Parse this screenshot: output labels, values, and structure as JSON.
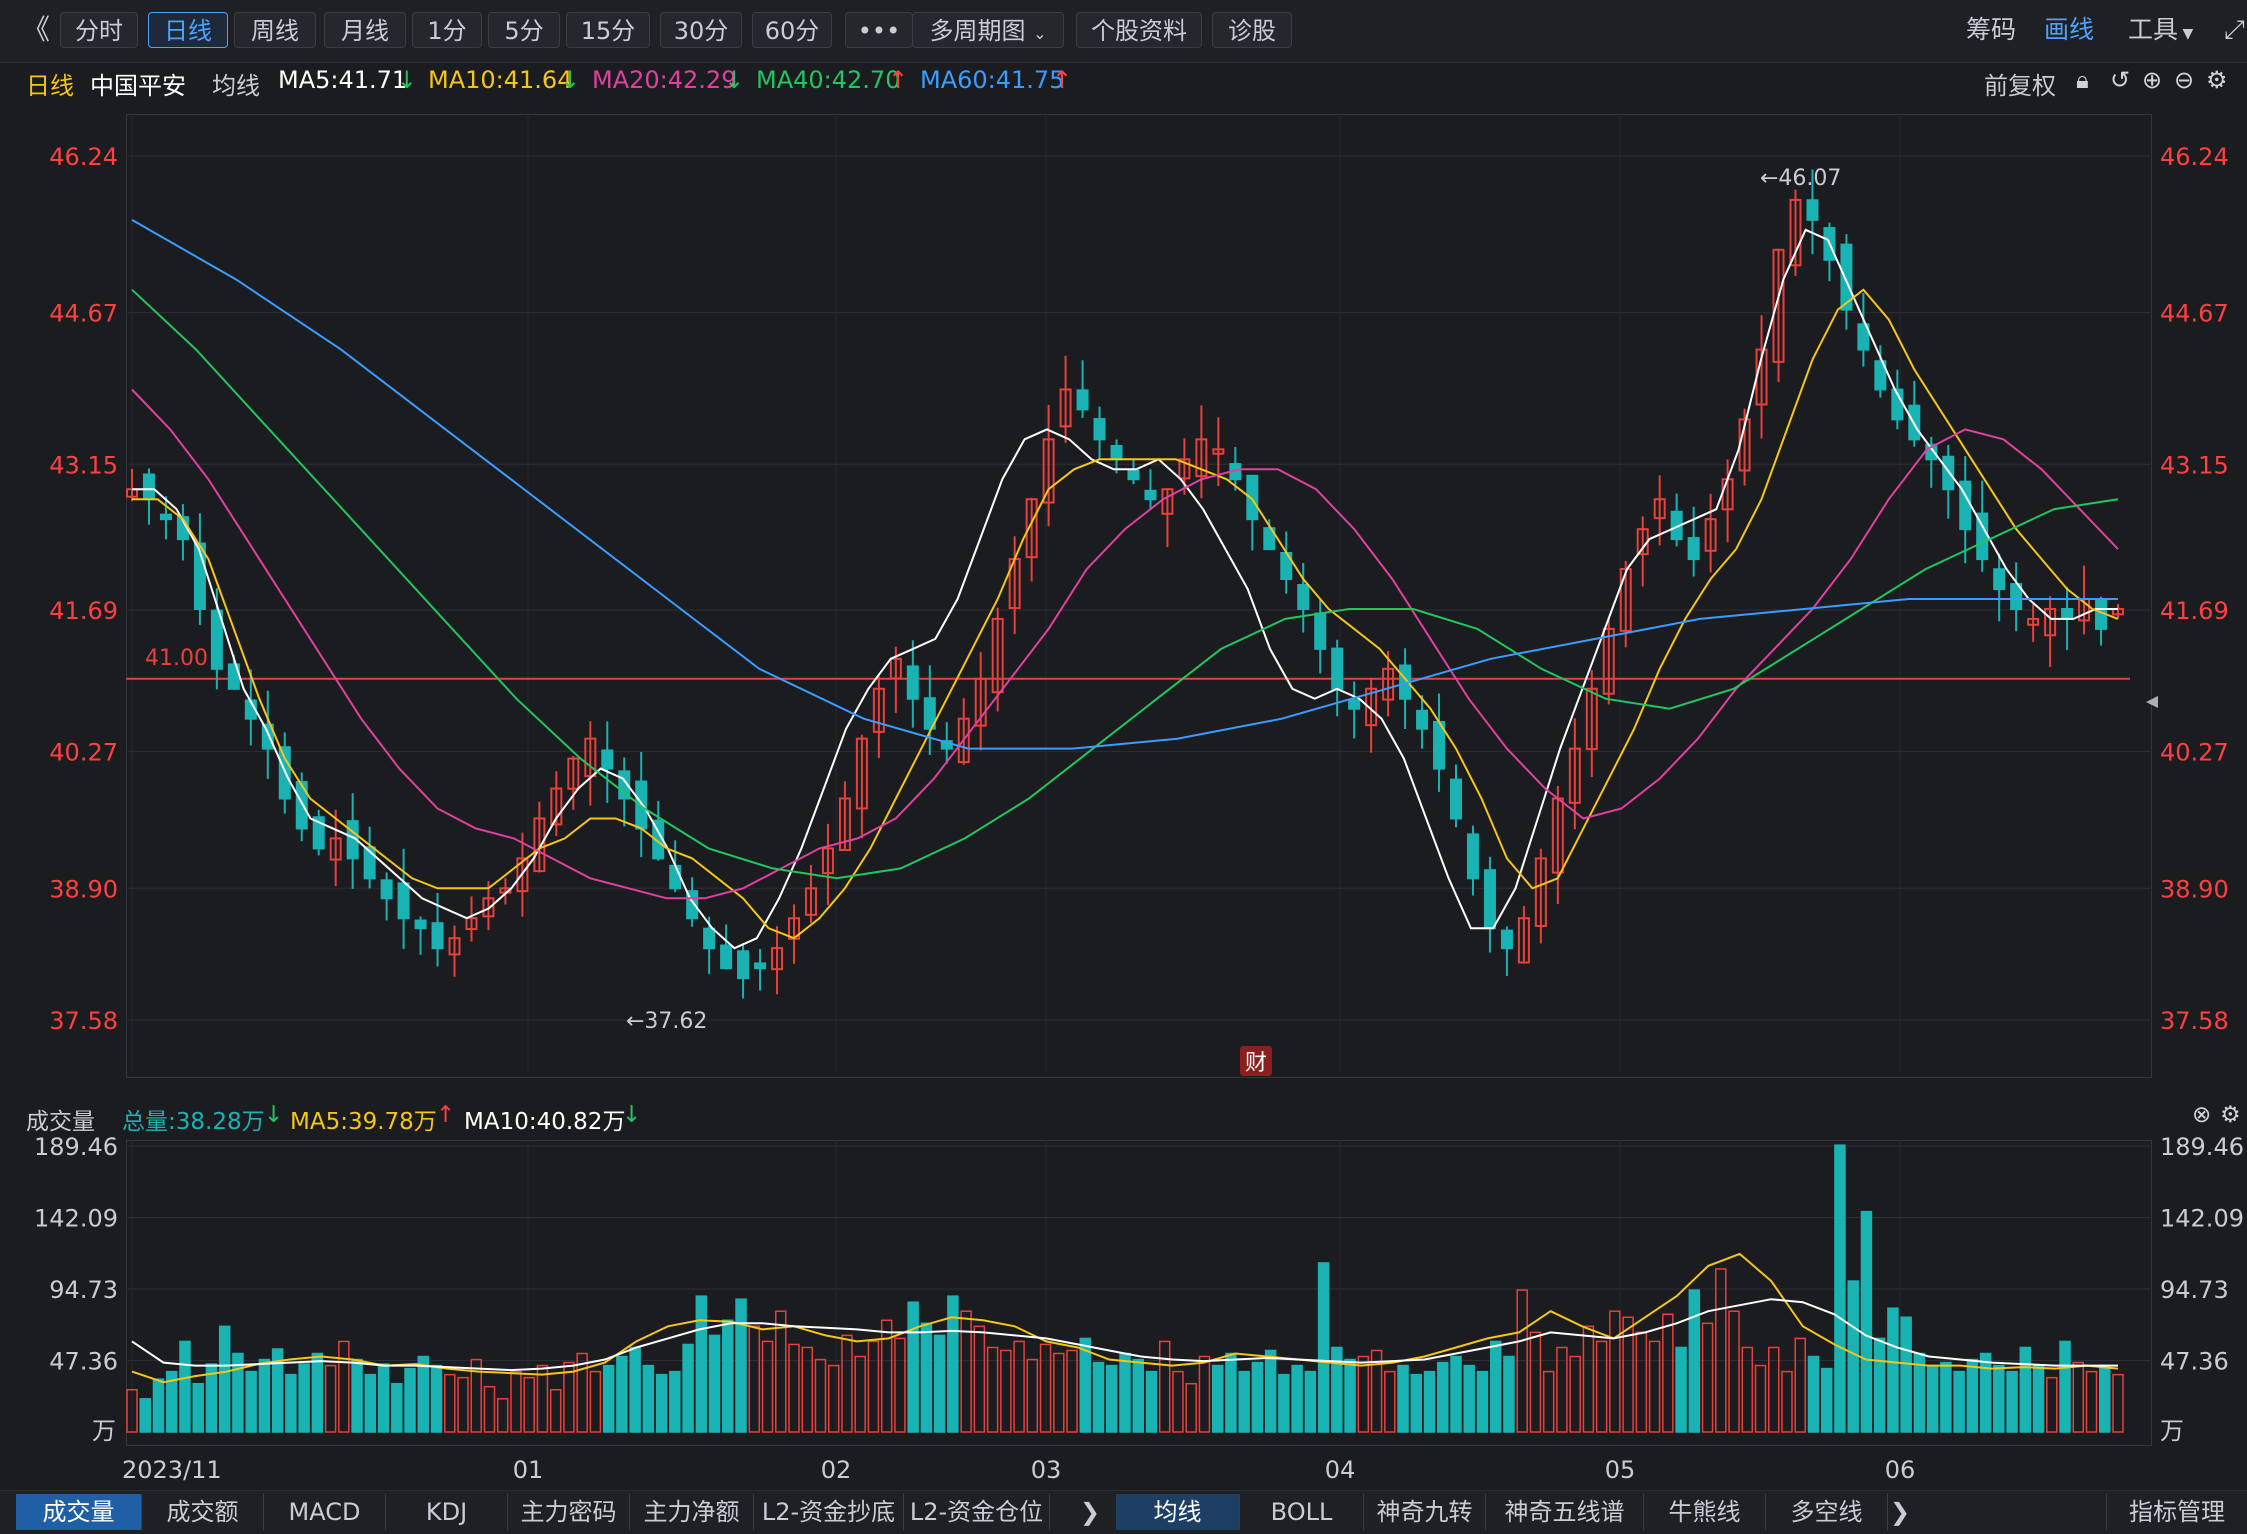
{
  "toolbar": {
    "back_icon": "double-chevron-left-icon",
    "tabs": [
      "分时",
      "日线",
      "周线",
      "月线",
      "1分",
      "5分",
      "15分",
      "30分",
      "60分"
    ],
    "more_label": "•••",
    "multi_period_label": "多周期图",
    "stock_info_label": "个股资料",
    "diagnose_label": "诊股",
    "chips_label": "筹码",
    "draw_label": "画线",
    "tools_label": "工具"
  },
  "indicator_line": {
    "period": "日线",
    "stock_name": "中国平安",
    "avg_label": "均线",
    "ma": [
      {
        "text": "MA5:41.71",
        "arrow": "↓",
        "color": "#ffffff",
        "arrow_color": "#22c55e"
      },
      {
        "text": "MA10:41.64",
        "arrow": "↓",
        "color": "#f5c518",
        "arrow_color": "#22c55e"
      },
      {
        "text": "MA20:42.29",
        "arrow": "↓",
        "color": "#e040a0",
        "arrow_color": "#22c55e"
      },
      {
        "text": "MA40:42.70",
        "arrow": "↑",
        "color": "#22c55e",
        "arrow_color": "#ff4040"
      },
      {
        "text": "MA60:41.75",
        "arrow": "↑",
        "color": "#3b9cff",
        "arrow_color": "#ff4040"
      }
    ],
    "adjust_label": "前复权"
  },
  "volume_header": {
    "title": "成交量",
    "total": "总量:38.28万",
    "total_arrow": "↓",
    "ma5": "MA5:39.78万",
    "ma5_arrow": "↑",
    "ma10": "MA10:40.82万",
    "ma10_arrow": "↓"
  },
  "bottom_tabs": {
    "left": [
      "成交量",
      "成交额",
      "MACD",
      "KDJ",
      "主力密码",
      "主力净额",
      "L2-资金抄底",
      "L2-资金仓位"
    ],
    "right": [
      "均线",
      "BOLL",
      "神奇九转",
      "神奇五线谱",
      "牛熊线",
      "多空线"
    ],
    "manage_label": "指标管理"
  },
  "colors": {
    "up": "#e8403a",
    "down": "#1ab3b3",
    "ma5": "#ffffff",
    "ma10": "#f5c518",
    "ma20": "#e040a0",
    "ma40": "#22c55e",
    "ma60": "#3b9cff",
    "axis_text": "#ff4040"
  },
  "chart_data": [
    {
      "type": "candlestick",
      "title": "中国平安 日线",
      "price_ticks": [
        46.24,
        44.67,
        43.15,
        41.69,
        40.27,
        38.9,
        37.58
      ],
      "ylim": [
        37.58,
        46.24
      ],
      "x_ticks": [
        "2023/11",
        "01",
        "02",
        "03",
        "04",
        "05",
        "06"
      ],
      "reference_line": {
        "label": "41.00",
        "value": 41.0
      },
      "annotations": [
        {
          "label": "←46.07",
          "value": 46.07
        },
        {
          "label": "←37.62",
          "value": 37.62
        },
        {
          "label": "财"
        }
      ],
      "close_path": [
        42.9,
        42.8,
        42.6,
        42.4,
        41.7,
        41.1,
        40.9,
        40.6,
        40.3,
        39.8,
        39.5,
        39.3,
        39.4,
        39.2,
        39.0,
        38.8,
        38.6,
        38.5,
        38.3,
        38.4,
        38.6,
        38.8,
        38.9,
        39.2,
        39.6,
        39.9,
        40.2,
        40.4,
        40.1,
        39.8,
        39.5,
        39.2,
        38.9,
        38.6,
        38.3,
        38.1,
        38.0,
        38.1,
        38.3,
        38.6,
        38.9,
        39.3,
        39.8,
        40.4,
        40.9,
        41.2,
        40.8,
        40.5,
        40.3,
        40.6,
        41.0,
        41.6,
        42.2,
        42.8,
        43.4,
        43.9,
        43.7,
        43.4,
        43.2,
        43.0,
        42.8,
        42.9,
        43.2,
        43.4,
        43.3,
        43.0,
        42.6,
        42.3,
        42.0,
        41.7,
        41.3,
        40.9,
        40.7,
        40.9,
        41.1,
        40.8,
        40.5,
        40.1,
        39.6,
        39.0,
        38.5,
        38.3,
        38.6,
        39.2,
        39.8,
        40.3,
        40.9,
        41.5,
        42.1,
        42.5,
        42.8,
        42.4,
        42.2,
        42.6,
        43.0,
        43.6,
        44.3,
        45.3,
        45.8,
        45.6,
        45.2,
        44.7,
        44.3,
        43.9,
        43.6,
        43.4,
        43.2,
        42.9,
        42.5,
        42.2,
        41.9,
        41.7,
        41.6,
        41.7,
        41.6,
        41.8,
        41.5,
        41.7
      ],
      "ma_series": [
        {
          "name": "MA5",
          "values": [
            42.9,
            42.9,
            42.7,
            42.3,
            41.6,
            40.9,
            40.5,
            40.0,
            39.6,
            39.5,
            39.4,
            39.2,
            39.0,
            38.8,
            38.7,
            38.6,
            38.7,
            38.9,
            39.2,
            39.6,
            39.9,
            40.1,
            40.0,
            39.7,
            39.3,
            38.8,
            38.5,
            38.3,
            38.4,
            38.8,
            39.3,
            39.9,
            40.5,
            40.9,
            41.2,
            41.3,
            41.4,
            41.8,
            42.4,
            43.0,
            43.4,
            43.5,
            43.4,
            43.2,
            43.1,
            43.1,
            43.2,
            43.0,
            42.7,
            42.3,
            41.9,
            41.3,
            40.9,
            40.8,
            40.9,
            40.8,
            40.6,
            40.2,
            39.6,
            39.0,
            38.5,
            38.5,
            38.9,
            39.6,
            40.3,
            40.9,
            41.5,
            42.1,
            42.4,
            42.5,
            42.6,
            42.7,
            43.3,
            44.2,
            45.0,
            45.5,
            45.4,
            44.9,
            44.4,
            43.9,
            43.5,
            43.2,
            42.9,
            42.5,
            42.1,
            41.8,
            41.6,
            41.6,
            41.7,
            41.7
          ]
        },
        {
          "name": "MA10",
          "values": [
            42.8,
            42.8,
            42.6,
            42.2,
            41.5,
            40.8,
            40.2,
            39.8,
            39.6,
            39.4,
            39.2,
            39.0,
            38.9,
            38.9,
            38.9,
            39.1,
            39.3,
            39.4,
            39.6,
            39.6,
            39.5,
            39.3,
            39.2,
            39.0,
            38.8,
            38.5,
            38.4,
            38.6,
            38.9,
            39.3,
            39.8,
            40.3,
            40.8,
            41.3,
            41.8,
            42.4,
            42.9,
            43.1,
            43.2,
            43.2,
            43.2,
            43.2,
            43.1,
            43.0,
            42.8,
            42.4,
            42.0,
            41.7,
            41.5,
            41.3,
            41.0,
            40.7,
            40.3,
            39.8,
            39.2,
            38.9,
            39.0,
            39.5,
            40.0,
            40.5,
            41.1,
            41.6,
            42.0,
            42.3,
            42.8,
            43.5,
            44.2,
            44.7,
            44.9,
            44.6,
            44.1,
            43.7,
            43.3,
            42.9,
            42.5,
            42.2,
            41.9,
            41.7,
            41.6
          ]
        },
        {
          "name": "MA20",
          "values": [
            43.9,
            43.5,
            43.0,
            42.4,
            41.8,
            41.2,
            40.6,
            40.1,
            39.7,
            39.5,
            39.4,
            39.2,
            39.0,
            38.9,
            38.8,
            38.8,
            38.9,
            39.1,
            39.3,
            39.4,
            39.6,
            40.0,
            40.5,
            41.0,
            41.5,
            42.1,
            42.5,
            42.8,
            43.0,
            43.1,
            43.1,
            42.9,
            42.5,
            42.0,
            41.4,
            40.8,
            40.3,
            39.9,
            39.6,
            39.7,
            40.0,
            40.4,
            40.9,
            41.3,
            41.7,
            42.2,
            42.8,
            43.3,
            43.5,
            43.4,
            43.1,
            42.7,
            42.3
          ]
        },
        {
          "name": "MA40",
          "values": [
            44.9,
            44.3,
            43.6,
            42.9,
            42.2,
            41.5,
            40.8,
            40.2,
            39.7,
            39.3,
            39.1,
            39.0,
            39.1,
            39.4,
            39.8,
            40.3,
            40.8,
            41.3,
            41.6,
            41.7,
            41.7,
            41.5,
            41.1,
            40.8,
            40.7,
            40.9,
            41.3,
            41.7,
            42.1,
            42.4,
            42.7,
            42.8
          ]
        },
        {
          "name": "MA60",
          "values": [
            45.6,
            45.0,
            44.3,
            43.5,
            42.7,
            41.9,
            41.1,
            40.6,
            40.3,
            40.3,
            40.4,
            40.6,
            40.9,
            41.2,
            41.4,
            41.6,
            41.7,
            41.8,
            41.8,
            41.8
          ]
        }
      ]
    },
    {
      "type": "bar",
      "title": "成交量",
      "unit": "万",
      "y_ticks": [
        189.46,
        142.09,
        94.73,
        47.36
      ],
      "ylim": [
        0,
        189.46
      ],
      "values": [
        28,
        22,
        35,
        40,
        60,
        32,
        45,
        70,
        52,
        40,
        48,
        55,
        38,
        45,
        52,
        44,
        60,
        48,
        38,
        45,
        32,
        42,
        50,
        44,
        38,
        36,
        48,
        30,
        22,
        40,
        36,
        44,
        28,
        46,
        52,
        40,
        44,
        50,
        56,
        44,
        38,
        40,
        58,
        90,
        64,
        74,
        88,
        70,
        60,
        80,
        58,
        56,
        48,
        44,
        64,
        50,
        60,
        74,
        62,
        86,
        72,
        64,
        90,
        80,
        70,
        56,
        54,
        60,
        48,
        58,
        52,
        54,
        62,
        46,
        44,
        52,
        48,
        40,
        60,
        40,
        32,
        50,
        44,
        52,
        40,
        46,
        54,
        38,
        44,
        40,
        112,
        56,
        48,
        50,
        54,
        40,
        44,
        38,
        40,
        46,
        50,
        44,
        40,
        60,
        50,
        94,
        66,
        40,
        56,
        50,
        70,
        60,
        80,
        76,
        66,
        60,
        78,
        56,
        94,
        72,
        108,
        80,
        56,
        44,
        56,
        40,
        62,
        50,
        42,
        190,
        100,
        146,
        62,
        82,
        76,
        52,
        44,
        46,
        40,
        48,
        52,
        44,
        40,
        56,
        44,
        36,
        60,
        46,
        40,
        44,
        38
      ],
      "ma_series": [
        {
          "name": "MA5",
          "values": [
            40,
            33,
            37,
            40,
            45,
            48,
            50,
            48,
            44,
            45,
            42,
            40,
            39,
            38,
            40,
            46,
            60,
            70,
            74,
            73,
            68,
            70,
            64,
            60,
            62,
            70,
            76,
            74,
            70,
            60,
            56,
            48,
            46,
            44,
            46,
            52,
            50,
            48,
            46,
            44,
            46,
            50,
            56,
            62,
            66,
            80,
            70,
            62,
            76,
            90,
            110,
            118,
            100,
            70,
            58,
            48,
            46,
            44,
            44,
            42,
            43,
            42,
            44,
            42
          ]
        },
        {
          "name": "MA10",
          "values": [
            60,
            46,
            44,
            44,
            45,
            46,
            47,
            46,
            44,
            44,
            43,
            42,
            41,
            42,
            44,
            48,
            56,
            62,
            68,
            72,
            72,
            70,
            69,
            68,
            66,
            66,
            67,
            66,
            64,
            62,
            58,
            54,
            50,
            48,
            47,
            48,
            49,
            48,
            47,
            46,
            47,
            48,
            52,
            56,
            60,
            66,
            64,
            62,
            66,
            72,
            80,
            84,
            88,
            86,
            78,
            64,
            56,
            50,
            48,
            46,
            45,
            44,
            44,
            44
          ]
        }
      ]
    }
  ]
}
